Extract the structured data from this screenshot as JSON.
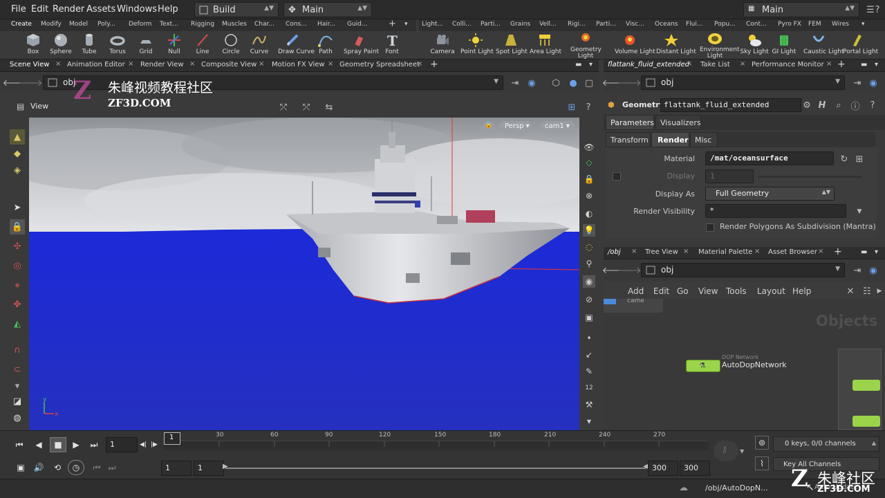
{
  "menu": [
    "File",
    "Edit",
    "Render",
    "Assets",
    "Windows",
    "Help"
  ],
  "desktop_left": "Build",
  "desktop_center": "Main",
  "desktop_right": "Main",
  "shelf_tabs_left": [
    "Create",
    "Modify",
    "Model",
    "Poly...",
    "Deform",
    "Text...",
    "Rigging",
    "Muscles",
    "Char...",
    "Cons...",
    "Hair...",
    "Guid..."
  ],
  "shelf_tabs_right": [
    "Light...",
    "Colli...",
    "Parti...",
    "Grains",
    "Vell...",
    "Rigi...",
    "Parti...",
    "Visc...",
    "Oceans",
    "Flui...",
    "Popu...",
    "Cont...",
    "Pyro FX",
    "FEM",
    "Wires"
  ],
  "tools_left": [
    "Box",
    "Sphere",
    "Tube",
    "Torus",
    "Grid",
    "Null",
    "Line",
    "Circle",
    "Curve",
    "Draw Curve",
    "Path",
    "Spray Paint",
    "Font"
  ],
  "tools_right": [
    "Camera",
    "Point Light",
    "Spot Light",
    "Area Light",
    "Geometry Light",
    "Volume Light",
    "Distant Light",
    "Environment Light",
    "Sky Light",
    "GI Light",
    "Caustic Light",
    "Portal Light"
  ],
  "viewer_tabs": [
    "Scene View",
    "Animation Editor",
    "Render View",
    "Composite View",
    "Motion FX View",
    "Geometry Spreadsheet"
  ],
  "viewer_path": "obj",
  "view_label": "View",
  "viewport_persp": "Persp",
  "viewport_cam": "cam1",
  "axis_y": "y",
  "axis_x": "x",
  "params_tabs": [
    "flattank_fluid_extended",
    "Take List",
    "Performance Monitor"
  ],
  "params_path": "obj",
  "node_type": "Geometry",
  "node_name": "flattank_fluid_extended",
  "param_section_tabs": [
    "Parameters",
    "Visualizers"
  ],
  "param_sub_tabs": [
    "Transform",
    "Render",
    "Misc"
  ],
  "material_label": "Material",
  "material_value": "/mat/oceansurface",
  "display_label": "Display",
  "display_value": "1",
  "display_as_label": "Display As",
  "display_as_value": "Full Geometry",
  "render_vis_label": "Render Visibility",
  "render_vis_value": "*",
  "render_poly_label": "Render Polygons As Subdivision (Mantra)",
  "network_tabs": [
    "/obj",
    "Tree View",
    "Material Palette",
    "Asset Browser"
  ],
  "network_path": "obj",
  "network_menu": [
    "Add",
    "Edit",
    "Go",
    "View",
    "Tools",
    "Layout",
    "Help"
  ],
  "network_watermark": "Objects",
  "node_small_label": "DOP Network",
  "node_label": "AutoDopNetwork",
  "cam_node_label": "came",
  "timeline_ticks": [
    "30",
    "60",
    "90",
    "120",
    "150",
    "180",
    "210",
    "240",
    "270"
  ],
  "current_frame": "1",
  "frame_marker": "1",
  "range_start": "1",
  "range_start2": "1",
  "range_end": "300",
  "range_end2": "300",
  "keys_info": "0 keys, 0/0 channels",
  "key_all_channels": "Key All Channels",
  "status_path": "/obj/AutoDopN...",
  "status_auto_update": "Auto Update",
  "watermark_cn": "朱峰视频教程社区",
  "watermark_url": "ZF3D.COM",
  "watermark_cn2": "朱峰社区",
  "watermark_url2": "ZF3D.COM"
}
